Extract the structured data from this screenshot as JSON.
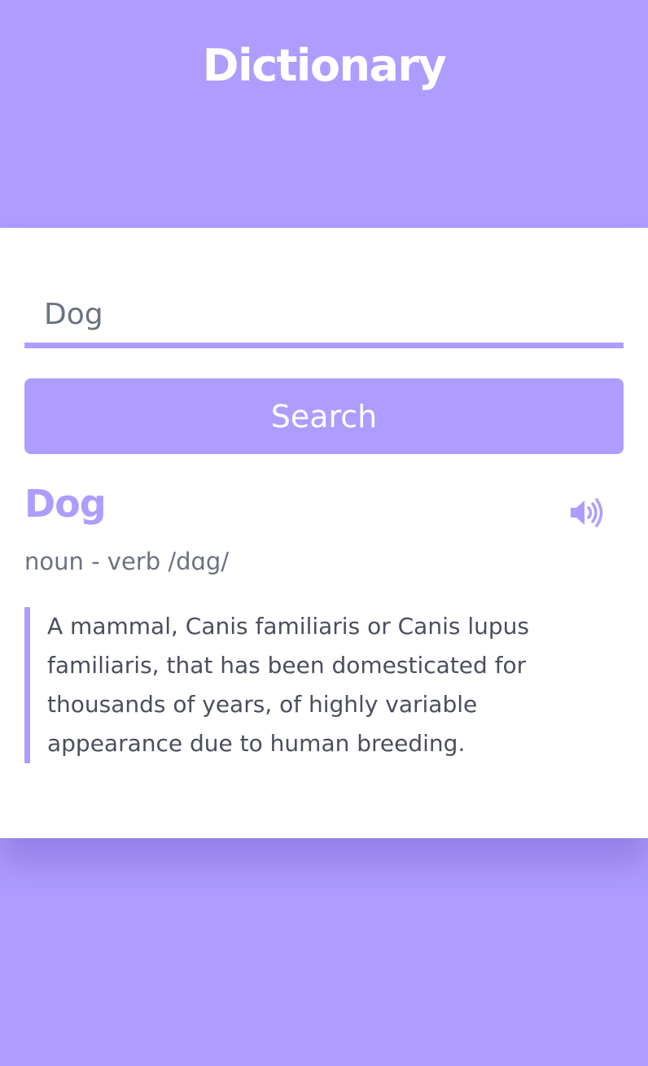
{
  "app": {
    "title": "Dictionary"
  },
  "search": {
    "value": "Dog",
    "button_label": "Search"
  },
  "result": {
    "word": "Dog",
    "part_of_speech": "noun - verb",
    "phonetic": "/dɑg/",
    "definition": "A mammal, Canis familiaris or Canis lupus familiaris, that has been domesticated for thousands of years, of highly variable appearance due to human breeding.",
    "sound_icon": "volume-up-icon"
  },
  "colors": {
    "accent": "#ae9cff",
    "background": "#ae9cff",
    "card": "#ffffff",
    "text_muted": "#6b7280",
    "text_body": "#4b4f5c"
  }
}
